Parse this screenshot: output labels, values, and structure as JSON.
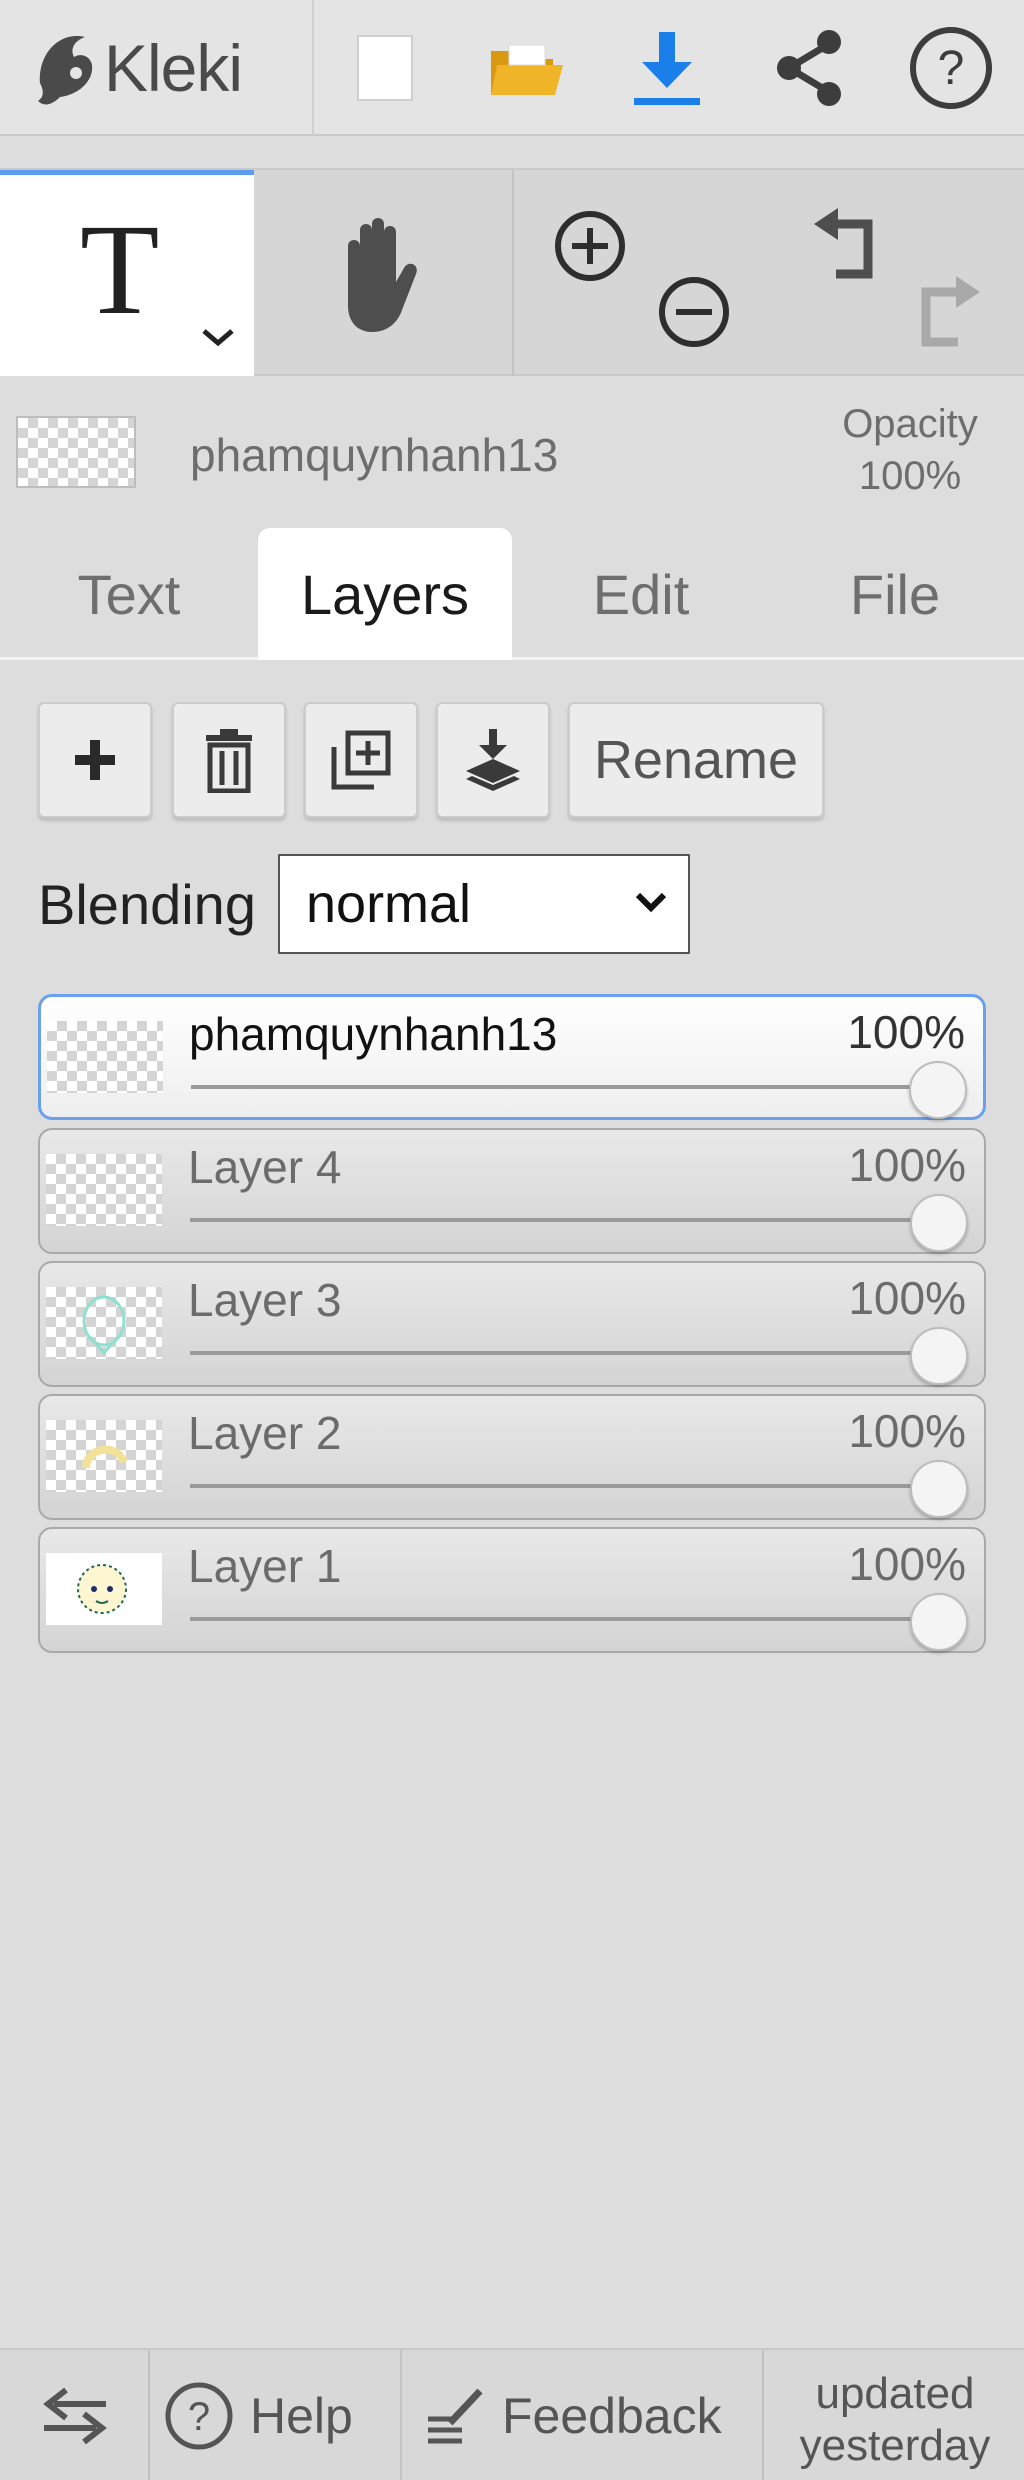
{
  "app": {
    "name": "Kleki"
  },
  "toolbar": {
    "new_icon": "new-file-icon",
    "open_icon": "open-folder-icon",
    "download_icon": "download-icon",
    "share_icon": "share-icon",
    "help_icon": "help-icon",
    "accent_color": "#1a7fe8",
    "folder_color": "#f0b428"
  },
  "tools": {
    "active_tool_glyph": "T",
    "active_tool_name": "text-tool",
    "active_tab_accent": "#5b9bf0"
  },
  "layer_info": {
    "name": "phamquynhanh13",
    "opacity_label": "Opacity",
    "opacity_value": "100%"
  },
  "tabs": [
    {
      "label": "Text",
      "active": false
    },
    {
      "label": "Layers",
      "active": true
    },
    {
      "label": "Edit",
      "active": false
    },
    {
      "label": "File",
      "active": false
    }
  ],
  "layer_buttons": {
    "rename_label": "Rename"
  },
  "blending": {
    "label": "Blending",
    "value": "normal"
  },
  "layers": [
    {
      "name": "phamquynhanh13",
      "opacity": "100%",
      "selected": true,
      "opacity_fraction": 1.0
    },
    {
      "name": "Layer 4",
      "opacity": "100%",
      "selected": false,
      "opacity_fraction": 1.0
    },
    {
      "name": "Layer 3",
      "opacity": "100%",
      "selected": false,
      "opacity_fraction": 1.0
    },
    {
      "name": "Layer 2",
      "opacity": "100%",
      "selected": false,
      "opacity_fraction": 1.0
    },
    {
      "name": "Layer 1",
      "opacity": "100%",
      "selected": false,
      "opacity_fraction": 1.0
    }
  ],
  "footer": {
    "help_label": "Help",
    "feedback_label": "Feedback",
    "updated_line1": "updated",
    "updated_line2": "yesterday"
  }
}
